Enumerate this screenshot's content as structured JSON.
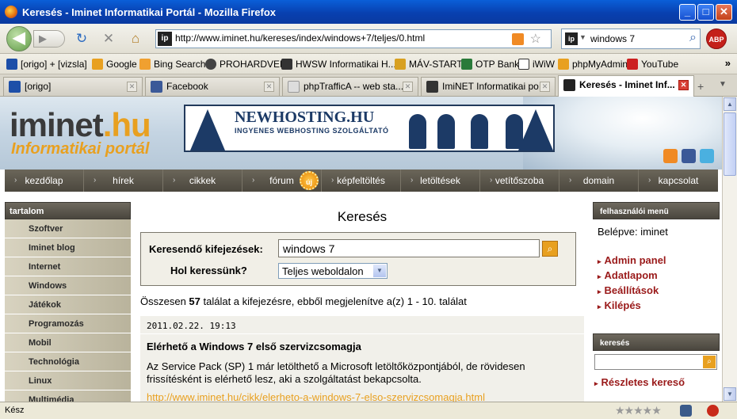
{
  "window": {
    "title": "Keresés - Iminet Informatikai Portál - Mozilla Firefox",
    "minimize": "_",
    "maximize": "□",
    "close": "✕"
  },
  "nav": {
    "back": "◀",
    "forward": "▶",
    "reload": "↻",
    "stop": "✕",
    "home": "⌂",
    "url": "http://www.iminet.hu/kereses/index/windows+7/teljes/0.html",
    "site_icon": "ip",
    "search_value": "windows 7",
    "abp": "ABP"
  },
  "bookmarks": [
    {
      "label": "[origo] + [vizsla]",
      "color": "#1d4fa8"
    },
    {
      "label": "Google",
      "color": "#e8a020"
    },
    {
      "label": "Bing Search",
      "color": "#f0a030"
    },
    {
      "label": "PROHARDVER",
      "color": "#444444"
    },
    {
      "label": "HWSW Informatikai H...",
      "color": "#333333"
    },
    {
      "label": "MÁV-START",
      "color": "#d8a020"
    },
    {
      "label": "OTP Bank",
      "color": "#2a7a3a"
    },
    {
      "label": "iWiW",
      "color": "#ffffff"
    },
    {
      "label": "phpMyAdmin",
      "color": "#e8a020"
    },
    {
      "label": "YouTube",
      "color": "#cc2020"
    }
  ],
  "bookmarks_more": "»",
  "tabs": [
    {
      "label": "[origo]",
      "color": "#1d4fa8"
    },
    {
      "label": "Facebook",
      "color": "#3b5998"
    },
    {
      "label": "phpTraffic​A -- web sta...",
      "color": "#cccccc"
    },
    {
      "label": "ImiNET Informatikai po...",
      "color": "#333333"
    },
    {
      "label": "Keresés - Iminet Inf...",
      "color": "#222222"
    }
  ],
  "tab_new": "+",
  "tab_list": "▼",
  "header": {
    "logo_main": "iminet",
    "logo_tld": ".hu",
    "logo_sub": "Informatikai portál",
    "banner_title": "NEWHOSTING.HU",
    "banner_sub": "INGYENES WEBHOSTING SZOLGÁLTATÓ",
    "new_badge": "új"
  },
  "menu": [
    "kezdőlap",
    "hírek",
    "cikkek",
    "fórum",
    "képfeltöltés",
    "letöltések",
    "vetítőszoba",
    "domain",
    "kapcsolat"
  ],
  "left": {
    "heading": "tartalom",
    "items": [
      "Szoftver",
      "Iminet blog",
      "Internet",
      "Windows",
      "Játékok",
      "Programozás",
      "Mobil",
      "Technológia",
      "Linux",
      "Multimédia"
    ]
  },
  "main": {
    "heading": "Keresés",
    "query_label": "Keresendő kifejezések:",
    "query_value": "windows 7",
    "where_label": "Hol keressünk?",
    "where_value": "Teljes weboldalon",
    "summary_pre": "Összesen ",
    "summary_count": "57",
    "summary_post": " találat a kifejezésre, ebből megjelenítve a(z) 1 - 10. találat",
    "result": {
      "date": "2011.02.22. 19:13",
      "title": "Elérhető a Windows 7 első szervizcsomagja",
      "text": "Az Service Pack (SP) 1 már letölthető a Microsoft letöltőközpontjából, de rövidesen frissítésként is elérhető lesz, aki a szolgáltatást bekapcsolta.",
      "link": "http://www.iminet.hu/cikk/elerheto-a-windows-7-elso-szervizcsomagja.html"
    }
  },
  "right": {
    "user_heading": "felhasználói menü",
    "logged_in": "Belépve: iminet",
    "links": [
      "Admin panel",
      "Adatlapom",
      "Beállítások",
      "Kilépés"
    ],
    "search_heading": "keresés",
    "detail_link": "Részletes kereső"
  },
  "status": {
    "text": "Kész",
    "stars": "★★★★★"
  }
}
